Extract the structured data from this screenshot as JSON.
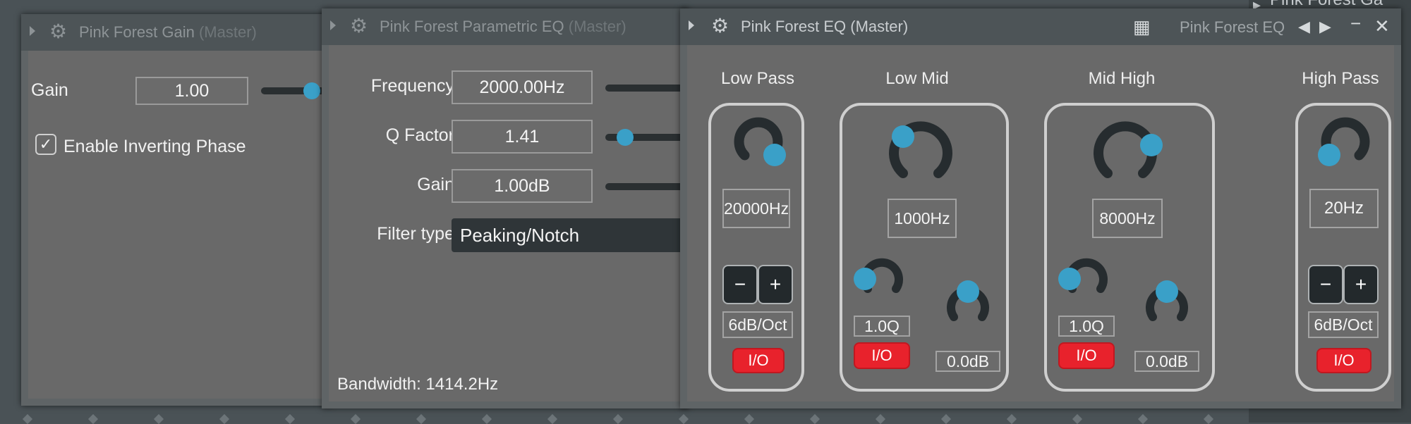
{
  "background": {
    "right_title": "Pink Forest Ga"
  },
  "gain_window": {
    "title": "Pink Forest Gain",
    "title_suffix": "(Master)",
    "gain_label": "Gain",
    "gain_value": "1.00",
    "checkbox_label": "Enable Inverting Phase",
    "checkbox_checked": true
  },
  "param_eq_window": {
    "title": "Pink Forest Parametric EQ",
    "title_suffix": "(Master)",
    "frequency_label": "Frequency",
    "frequency_value": "2000.00Hz",
    "q_label": "Q Factor",
    "q_value": "1.41",
    "gain_label": "Gain",
    "gain_value": "1.00dB",
    "filter_label": "Filter type",
    "filter_value": "Peaking/Notch",
    "bandwidth": "Bandwidth: 1414.2Hz"
  },
  "eq_window": {
    "title": "Pink Forest EQ (Master)",
    "preset_name": "Pink Forest EQ",
    "low_pass": {
      "label": "Low Pass",
      "freq": "20000Hz",
      "slope": "6dB/Oct",
      "io": "I/O"
    },
    "low_mid": {
      "label": "Low Mid",
      "freq": "1000Hz",
      "q": "1.0Q",
      "gain": "0.0dB",
      "io": "I/O"
    },
    "mid_high": {
      "label": "Mid High",
      "freq": "8000Hz",
      "q": "1.0Q",
      "gain": "0.0dB",
      "io": "I/O"
    },
    "high_pass": {
      "label": "High Pass",
      "freq": "20Hz",
      "slope": "6dB/Oct",
      "io": "I/O"
    },
    "minus": "−",
    "plus": "+"
  },
  "colors": {
    "accent": "#3aa0c8",
    "io_red": "#e8222c",
    "knob_dark": "#262c2f"
  }
}
